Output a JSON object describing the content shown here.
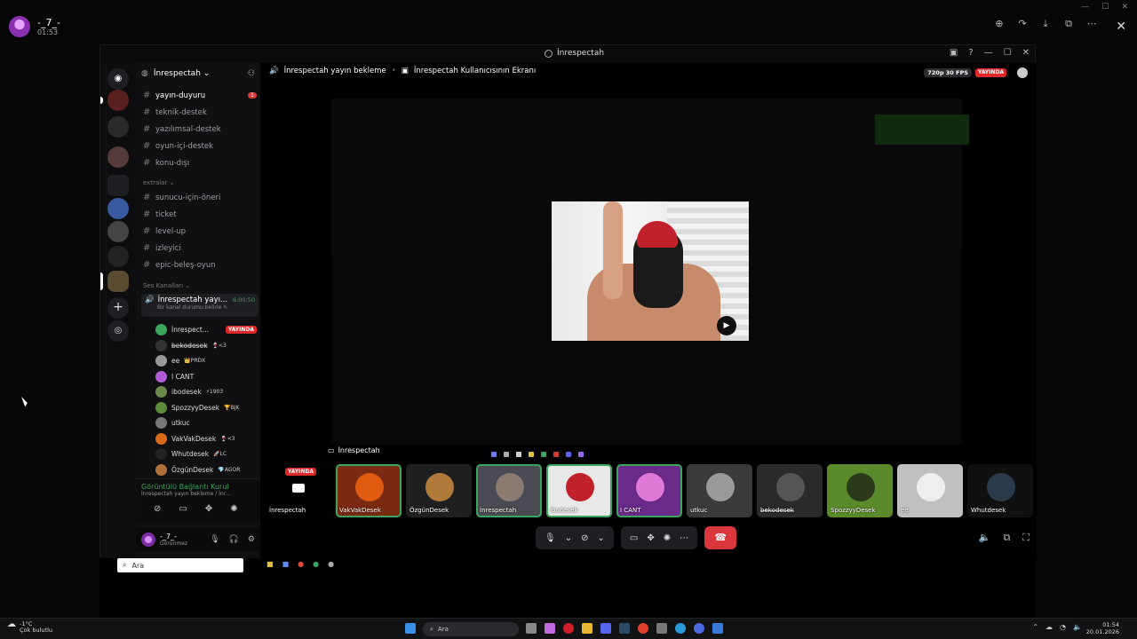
{
  "viewer": {
    "user_name": "-_7_-",
    "user_time": "01:53",
    "tools": [
      "⊕",
      "↷",
      "⤓",
      "⧉",
      "⋯"
    ],
    "close": "✕"
  },
  "window": {
    "title": "İnrespectah",
    "controls": [
      "—",
      "☐",
      "✕"
    ]
  },
  "server": {
    "name": "İnrespectah ⌄",
    "channels": [
      {
        "label": "yayın-duyuru",
        "active": true,
        "badge": "1"
      },
      {
        "label": "teknik-destek"
      },
      {
        "label": "yazılımsal-destek"
      },
      {
        "label": "oyun-içi-destek"
      },
      {
        "label": "konu-dışı"
      }
    ],
    "category_extra": "extralar ⌄",
    "extra_channels": [
      {
        "label": "sunucu-için-öneri"
      },
      {
        "label": "ticket"
      },
      {
        "label": "level-up"
      },
      {
        "label": "izleyici"
      },
      {
        "label": "epic-beleş-oyun"
      }
    ],
    "category_voice": "Ses Kanalları ⌄",
    "voice_channel": {
      "name": "İnrespectah yayı...",
      "timer": "6:00:50",
      "subtitle": "Bir kanal durumu belirle ✎"
    },
    "members": [
      {
        "name": "İnrespect...",
        "tag": "",
        "live": "YAYINDA",
        "color": "#3ba55d"
      },
      {
        "name": "b̶e̶k̶o̶d̶e̶s̶e̶k̶",
        "tag": "🍷<3",
        "color": "#333"
      },
      {
        "name": "ee",
        "tag": "👑PRDX",
        "color": "#999"
      },
      {
        "name": "I CANT",
        "tag": "",
        "color": "#b05ad8"
      },
      {
        "name": "ibodesek",
        "tag": "⚡1903",
        "color": "#6b8a4a"
      },
      {
        "name": "SpozzyyDesek",
        "tag": "🏆BJK",
        "color": "#5f8c3a"
      },
      {
        "name": "utkuc",
        "tag": "",
        "color": "#777"
      },
      {
        "name": "VakVakDesek",
        "tag": "🍷<3",
        "color": "#d96a1a"
      },
      {
        "name": "Whutdesek",
        "tag": "🚀LC",
        "color": "#222"
      },
      {
        "name": "ÖzgünDesek",
        "tag": "💎AGOR",
        "color": "#b0703a"
      }
    ],
    "connection": {
      "title": "Görüntülü Bağlantı Kurul",
      "subtitle": "İnrespectah yayın bekleme / İnr..."
    },
    "self": {
      "name": "-_7_-",
      "status": "Görünmez"
    }
  },
  "stream": {
    "channel": "İnrespectah yayın bekleme",
    "separator": "•",
    "screen_title": "İnrespectah Kullanıcısının Ekranı",
    "quality": "720p 30 FPS",
    "live": "YAYINDA",
    "screen_label": "İnrespectah",
    "play_icon": "▶"
  },
  "participants": [
    {
      "name": "İnrespectah",
      "live": "YAYINDA",
      "bg": "#000000",
      "av": "#ffffff"
    },
    {
      "name": "VakVakDesek",
      "bg": "#7a2a10",
      "av": "#e05a10",
      "speaking": true
    },
    {
      "name": "ÖzgünDesek",
      "bg": "#1f1f1f",
      "av": "#b07a3a"
    },
    {
      "name": "İnrespectah",
      "bg": "#4a4a52",
      "av": "#8a7a70",
      "speaking": true
    },
    {
      "name": "ibodesek",
      "bg": "#e8e8e8",
      "av": "#c0212a",
      "speaking": true
    },
    {
      "name": "I CANT",
      "bg": "#6a2a8a",
      "av": "#e07ad8",
      "speaking": true
    },
    {
      "name": "utkuc",
      "bg": "#3a3a3a",
      "av": "#9a9a9a"
    },
    {
      "name": "b̶e̶k̶o̶d̶e̶s̶e̶k̶",
      "bg": "#2a2a2a",
      "av": "#555555"
    },
    {
      "name": "SpozzyyDesek",
      "bg": "#5a8a2a",
      "av": "#2a3a1a"
    },
    {
      "name": "ee",
      "bg": "#c0c0c0",
      "av": "#eeeeee"
    },
    {
      "name": "Whutdesek",
      "bg": "#101010",
      "av": "#2a3a4a"
    }
  ],
  "search": {
    "placeholder": "Ara"
  },
  "taskbar": {
    "weather_temp": "-1°C",
    "weather_desc": "Çok bulutlu",
    "search": "Ara",
    "time": "01:54",
    "date": "20.01.2026"
  }
}
